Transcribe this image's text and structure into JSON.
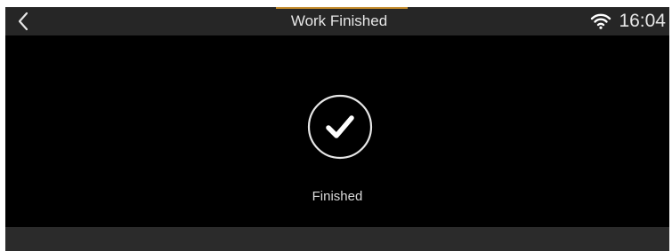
{
  "header": {
    "title": "Work Finished",
    "back_icon": "chevron-left-icon",
    "wifi_icon": "wifi-icon",
    "time": "16:04"
  },
  "main": {
    "status_icon": "check-circle-icon",
    "message": "Finished"
  },
  "colors": {
    "screen_background": "#000000",
    "header_background": "#262626",
    "footer_background": "#2b2b2b",
    "accent": "#c28a2c",
    "text": "#e6e6e6"
  }
}
